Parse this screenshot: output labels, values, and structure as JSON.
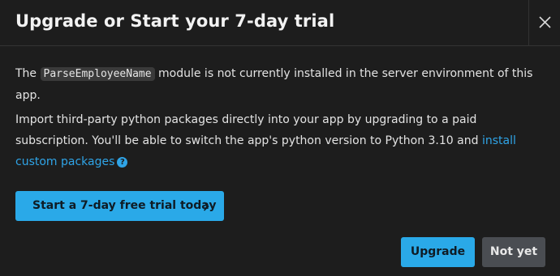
{
  "dialog": {
    "title": "Upgrade or Start your 7-day trial",
    "close_icon": "close-icon"
  },
  "message": {
    "p1_prefix": "The ",
    "module_name": "ParseEmployeeName",
    "p1_suffix": " module is not currently installed in the server environment of this app.",
    "p2_text": "Import third-party python packages directly into your app by upgrading to a paid subscription. You'll be able to switch the app's python version to Python 3.10 and ",
    "p2_link": "install custom packages",
    "help_icon": "?"
  },
  "actions": {
    "trial_label": "Start a 7-day free trial today",
    "upgrade_label": "Upgrade",
    "not_yet_label": "Not yet"
  },
  "colors": {
    "background": "#1d1d1d",
    "accent": "#2aa9e8",
    "link": "#2fa4e7",
    "secondary_button": "#4a4d52"
  }
}
